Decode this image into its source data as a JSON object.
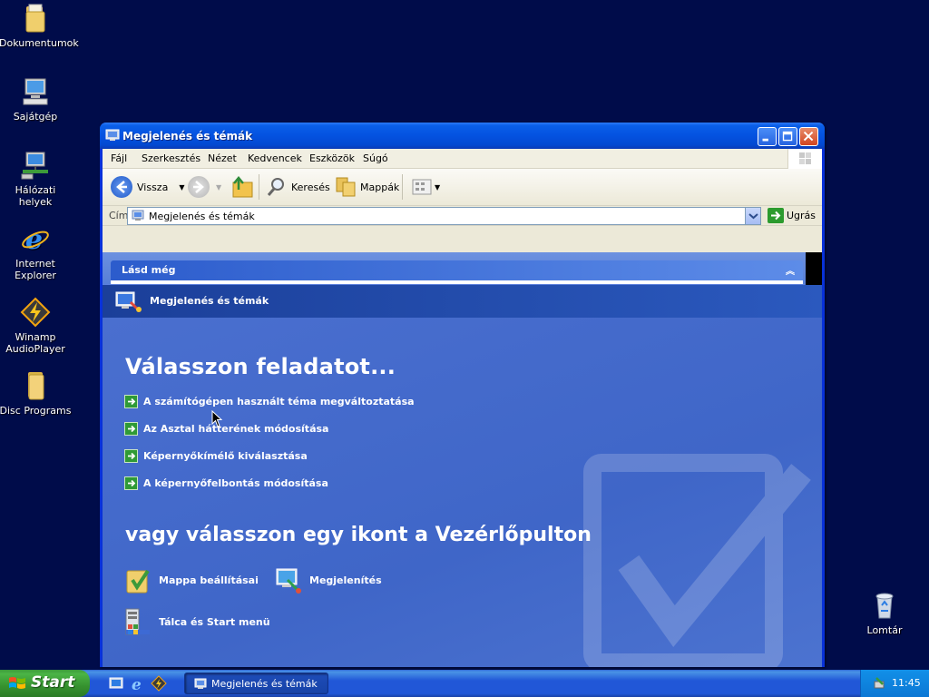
{
  "desktop": {
    "icons": [
      {
        "label": "Dokumentumok",
        "icon": "folder-documents-icon"
      },
      {
        "label": "Sajátgép",
        "icon": "my-computer-icon"
      },
      {
        "label": "Hálózati helyek",
        "icon": "network-places-icon"
      },
      {
        "label": "Internet\nExplorer",
        "icon": "internet-explorer-icon"
      },
      {
        "label": "Winamp\nAudioPlayer",
        "icon": "winamp-icon"
      },
      {
        "label": "Disc Programs",
        "icon": "folder-icon"
      },
      {
        "label": "Lomtár",
        "icon": "recycle-bin-icon"
      }
    ]
  },
  "window": {
    "title": "Megjelenés és témák",
    "menu": [
      "Fájl",
      "Szerkesztés",
      "Nézet",
      "Kedvencek",
      "Eszközök",
      "Súgó"
    ],
    "toolbar": {
      "back": "Vissza",
      "search": "Keresés",
      "folders": "Mappák"
    },
    "address": {
      "label": "Cím",
      "value": "Megjelenés és témák",
      "go": "Ugrás"
    },
    "see_also": "Lásd még",
    "category_title": "Megjelenés és témák",
    "pick_task": "Válasszon feladatot...",
    "tasks": [
      "A számítógépen használt téma megváltoztatása",
      "Az Asztal hátterének módosítása",
      "Képernyőkímélő kiválasztása",
      "A képernyőfelbontás módosítása"
    ],
    "pick_icon": "vagy válasszon egy ikont a Vezérlőpulton",
    "cp_icons": [
      {
        "label": "Mappa beállításai",
        "icon": "folder-options-icon"
      },
      {
        "label": "Megjelenítés",
        "icon": "display-icon"
      },
      {
        "label": "Tálca és Start menü",
        "icon": "taskbar-start-menu-icon"
      }
    ]
  },
  "taskbar": {
    "start": "Start",
    "task_button": "Megjelenés és témák",
    "clock": "11:45"
  },
  "colors": {
    "desktop_bg": "#000c4a",
    "title_bar": "#0452e0",
    "content_bg": "#4a6fcf",
    "start_green": "#36922f"
  }
}
